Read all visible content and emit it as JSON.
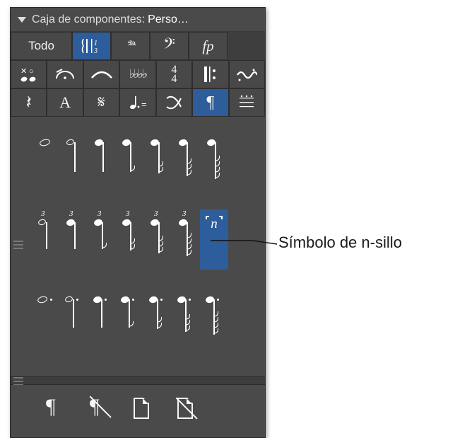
{
  "header": {
    "title": "Caja de componentes:",
    "preset": "Perso…"
  },
  "toolbar": {
    "row1": [
      "Todo",
      "clef-ts",
      "Ped.",
      "bass-clef",
      "fp"
    ],
    "row2": [
      "xo-chord",
      "fermata-arc",
      "slur",
      "flats",
      "4/4",
      "repeat",
      "trill-orn"
    ],
    "row3": [
      "rest",
      "A",
      "segno",
      "dotted-note",
      "swap",
      "pilcrow",
      "grid"
    ]
  },
  "symbols": {
    "row1": [
      "whole",
      "half",
      "quarter",
      "eighth",
      "sixteenth",
      "thirtysecond",
      "sixtyfourth"
    ],
    "row2": [
      "triplet-half",
      "triplet-quarter",
      "triplet-eighth",
      "triplet-sixteenth",
      "triplet-thirtysecond",
      "triplet-sixtyfourth",
      "n-tuplet"
    ],
    "row3": [
      "dotted-whole",
      "dotted-half",
      "dotted-quarter",
      "dotted-eighth",
      "dotted-sixteenth",
      "dotted-thirtysecond",
      "dotted-sixtyfourth"
    ],
    "n_label": "n"
  },
  "bottom": [
    "pilcrow",
    "pilcrow-slash",
    "page",
    "page-slash"
  ],
  "callout": "Símbolo de n-sillo"
}
